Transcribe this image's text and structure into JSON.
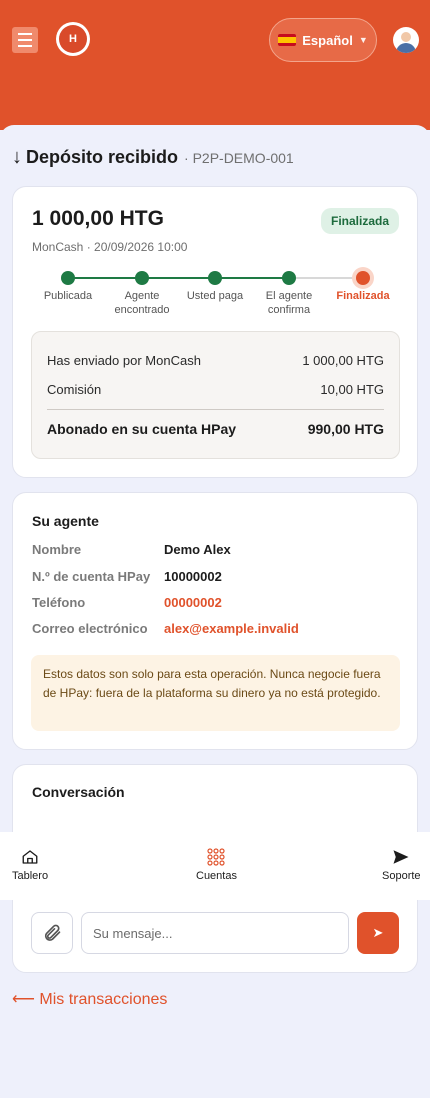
{
  "header": {
    "language": "Español",
    "logo_text": "H"
  },
  "page": {
    "arrow": "↓",
    "title": "Depósito recibido",
    "reference": "· P2P-DEMO-001"
  },
  "transaction": {
    "amount": "1 000,00 HTG",
    "status": "Finalizada",
    "meta": "MonCash · 20/09/2026 10:00",
    "steps": [
      {
        "label": "Publicada",
        "state": "done"
      },
      {
        "label": "Agente encontrado",
        "state": "done"
      },
      {
        "label": "Usted paga",
        "state": "done"
      },
      {
        "label": "El agente confirma",
        "state": "done"
      },
      {
        "label": "Finalizada",
        "state": "current"
      }
    ],
    "summary": {
      "sent_label": "Has enviado por MonCash",
      "sent_value": "1 000,00 HTG",
      "fee_label": "Comisión",
      "fee_value": "10,00 HTG",
      "credited_label": "Abonado en su cuenta HPay",
      "credited_value": "990,00 HTG"
    }
  },
  "agent": {
    "section_title": "Su agente",
    "name_label": "Nombre",
    "name_value": "Demo Alex",
    "account_label": "N.º de cuenta HPay",
    "account_value": "10000002",
    "phone_label": "Teléfono",
    "phone_value": "00000002",
    "email_label": "Correo electrónico",
    "email_value": "alex@example.invalid",
    "warning": "Estos datos son solo para esta operación. Nunca negocie fuera de HPay: fuera de la plataforma su dinero ya no está protegido."
  },
  "conversation": {
    "section_title": "Conversación",
    "message_placeholder": "Su mensaje...",
    "send_glyph": "➤"
  },
  "bottom_nav": {
    "dashboard": "Tablero",
    "accounts": "Cuentas",
    "support": "Soporte"
  },
  "footer": {
    "back_link": "⟵ Mis transacciones"
  },
  "colors": {
    "brand": "#e0522b",
    "success": "#1e7a44",
    "background": "#eef0fb"
  }
}
